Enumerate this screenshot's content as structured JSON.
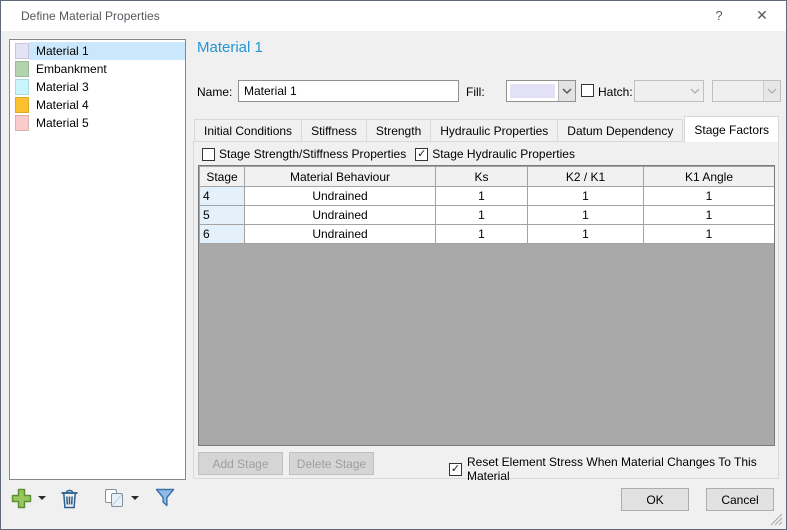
{
  "window": {
    "title": "Define Material Properties",
    "help_label": "?",
    "close_label": "✕"
  },
  "materials": {
    "items": [
      {
        "name": "Material 1",
        "color": "#E4E3F6",
        "selected": true
      },
      {
        "name": "Embankment",
        "color": "#B3D2AE",
        "selected": false
      },
      {
        "name": "Material 3",
        "color": "#C9F6FE",
        "selected": false
      },
      {
        "name": "Material 4",
        "color": "#FCC12E",
        "selected": false
      },
      {
        "name": "Material 5",
        "color": "#F9CBCB",
        "selected": false
      }
    ],
    "toolbar_icons": [
      "add-material-icon",
      "delete-material-icon",
      "copy-material-icon",
      "filter-materials-icon"
    ]
  },
  "editor": {
    "heading": "Material 1",
    "name_label": "Name:",
    "name_value": "Material 1",
    "fill_label": "Fill:",
    "fill_color": "#E2E1F5",
    "hatch": {
      "label": "Hatch:",
      "checked": false,
      "mark": ""
    }
  },
  "tabs": {
    "items": [
      "Initial Conditions",
      "Stiffness",
      "Strength",
      "Hydraulic Properties",
      "Datum Dependency",
      "Stage Factors"
    ],
    "active": "Stage Factors"
  },
  "stage_factors": {
    "checkboxes": [
      {
        "label": "Stage Strength/Stiffness Properties",
        "checked": false,
        "mark": ""
      },
      {
        "label": "Stage Hydraulic Properties",
        "checked": true,
        "mark": "✓"
      }
    ],
    "table": {
      "columns": [
        "Stage",
        "Material Behaviour",
        "Ks",
        "K2 / K1",
        "K1 Angle"
      ],
      "rows": [
        [
          "4",
          "Undrained",
          "1",
          "1",
          "1"
        ],
        [
          "5",
          "Undrained",
          "1",
          "1",
          "1"
        ],
        [
          "6",
          "Undrained",
          "1",
          "1",
          "1"
        ]
      ]
    },
    "add_stage_label": "Add Stage",
    "delete_stage_label": "Delete Stage",
    "reset_checkbox": {
      "label": "Reset Element Stress When Material Changes To This Material",
      "checked": true,
      "mark": "✓"
    }
  },
  "footer": {
    "ok_label": "OK",
    "cancel_label": "Cancel"
  }
}
